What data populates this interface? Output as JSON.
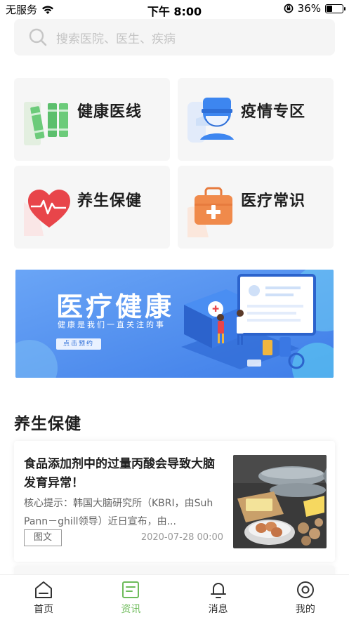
{
  "status_bar": {
    "carrier": "无服务",
    "time": "下午 8:00",
    "battery_percent": "36%",
    "battery_level": 0.36
  },
  "search": {
    "placeholder": "搜索医院、医生、疾病"
  },
  "categories": [
    {
      "label": "健康医线",
      "icon": "books-icon"
    },
    {
      "label": "疫情专区",
      "icon": "doctor-mask-icon"
    },
    {
      "label": "养生保健",
      "icon": "heartbeat-icon"
    },
    {
      "label": "医疗常识",
      "icon": "medical-kit-icon"
    }
  ],
  "banner": {
    "title": "医疗健康",
    "subtitle": "健康是我们一直关注的事",
    "button": "点击预约"
  },
  "section": {
    "title": "养生保健"
  },
  "article": {
    "title": "食品添加剂中的过量丙酸会导致大脑发育异常！",
    "summary": "核心提示：韩国大脑研究所（KBRI，由Suh　Pann－ghill领导）近日宣布，由...",
    "tag": "图文",
    "date": "2020-07-28 00:00"
  },
  "tabs": [
    {
      "label": "首页",
      "icon": "home-icon",
      "active": false
    },
    {
      "label": "资讯",
      "icon": "news-icon",
      "active": true
    },
    {
      "label": "消息",
      "icon": "bell-icon",
      "active": false
    },
    {
      "label": "我的",
      "icon": "profile-icon",
      "active": false
    }
  ],
  "colors": {
    "accent": "#6dbb5a",
    "banner_blue": "#4d8ff0"
  }
}
